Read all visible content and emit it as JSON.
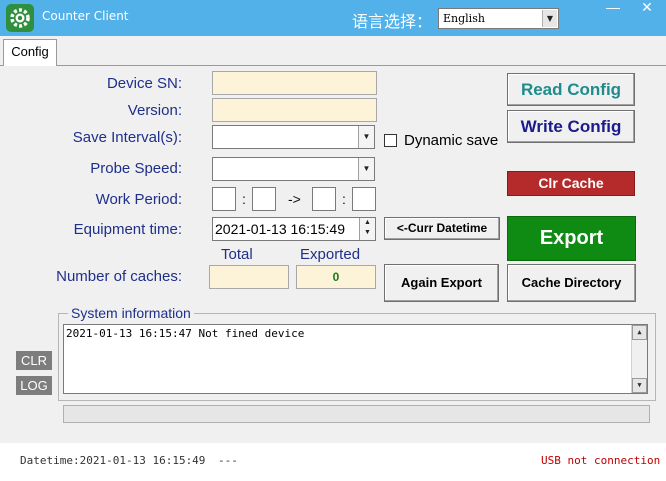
{
  "window": {
    "title": "Counter Client",
    "language_label": "语言选择：",
    "language_selected": "English",
    "minimize_glyph": "—",
    "close_glyph": "✕"
  },
  "tabs": [
    {
      "label": "Config",
      "active": true
    }
  ],
  "form": {
    "device_sn_label": "Device SN:",
    "device_sn_value": "",
    "version_label": "Version:",
    "version_value": "",
    "save_interval_label": "Save Interval(s):",
    "save_interval_value": "",
    "dynamic_save_label": "Dynamic save",
    "dynamic_save_checked": false,
    "probe_speed_label": "Probe Speed:",
    "probe_speed_value": "",
    "work_period_label": "Work Period:",
    "work_period_colon": ":",
    "work_period_arrow": "->",
    "equipment_time_label": "Equipment time:",
    "equipment_time_value": "2021-01-13 16:15:49",
    "caches_label": "Number of caches:",
    "total_header": "Total",
    "total_value": "",
    "exported_header": "Exported",
    "exported_value": "0"
  },
  "buttons": {
    "read_config": "Read Config",
    "write_config": "Write Config",
    "clr_cache": "Clr Cache",
    "curr_datetime": "<-Curr Datetime",
    "export": "Export",
    "again_export": "Again Export",
    "cache_directory": "Cache Directory",
    "clr": "CLR",
    "log": "LOG"
  },
  "system_info": {
    "title": "System information",
    "log_text": "2021-01-13 16:15:47 Not fined device"
  },
  "status_bar": {
    "datetime": "Datetime:2021-01-13 16:15:49",
    "separator": "---",
    "usb_status": "USB not connection"
  },
  "colors": {
    "title_bar": "#52b1e9",
    "label_text": "#1f2f8a",
    "readonly_field": "#fdf3d8",
    "clr_cache_bg": "#b52a2a",
    "export_bg": "#0f8a12",
    "usb_status_text": "#c00000",
    "exported_value_text": "#1a7a1a"
  },
  "icons": {
    "app_icon": "gear-icon",
    "combo_arrow": "chevron-down-icon",
    "spinner": "up-down-arrows-icon"
  }
}
